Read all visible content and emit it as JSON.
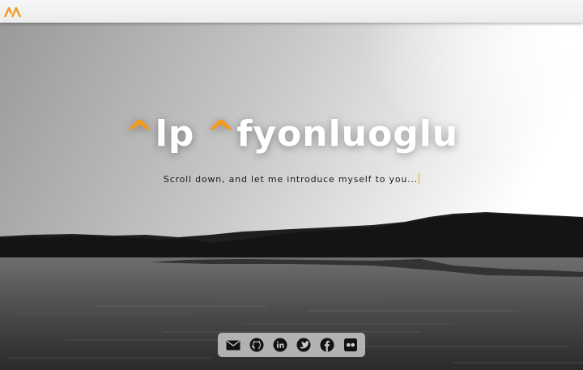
{
  "header": {
    "logo_icon": "aa-logo-icon",
    "accent_color": "#f39a21"
  },
  "hero": {
    "title_first_initial": "^",
    "title_first_rest": "lp",
    "title_last_initial": "^",
    "title_last_rest": "fyonluoglu",
    "subtitle": "Scroll down, and let me introduce myself to you..."
  },
  "social": {
    "items": [
      {
        "name": "email",
        "icon": "mail-icon"
      },
      {
        "name": "github",
        "icon": "github-icon"
      },
      {
        "name": "linkedin",
        "icon": "linkedin-icon"
      },
      {
        "name": "twitter",
        "icon": "twitter-icon"
      },
      {
        "name": "facebook",
        "icon": "facebook-icon"
      },
      {
        "name": "flickr",
        "icon": "flickr-icon"
      }
    ]
  }
}
